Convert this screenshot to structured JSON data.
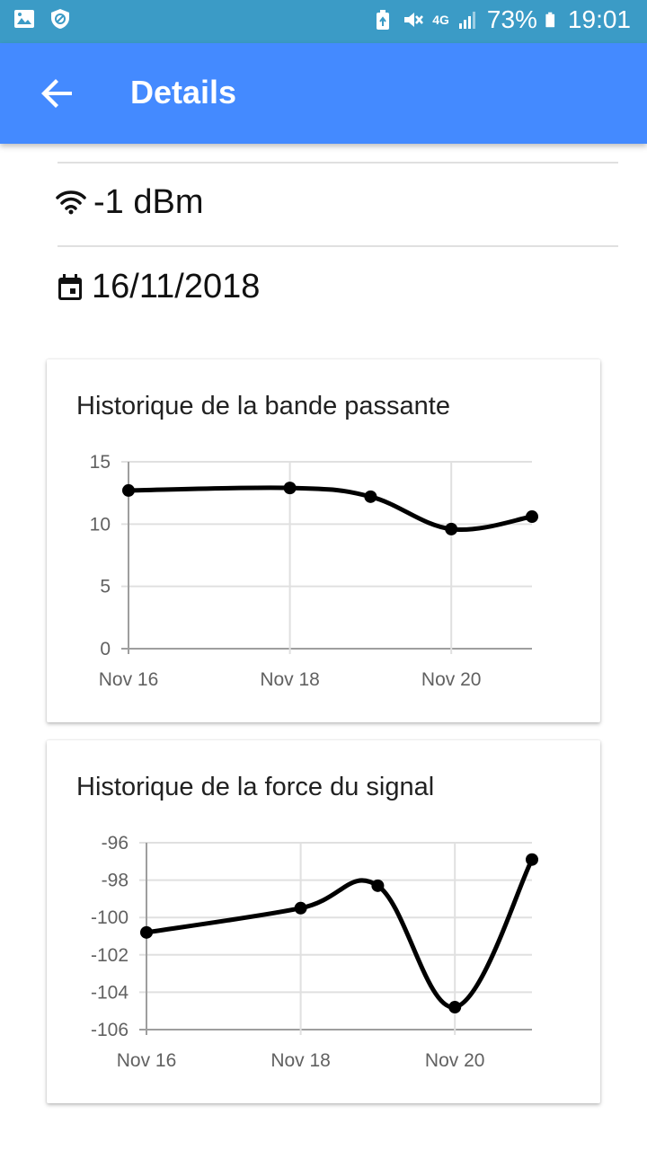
{
  "status_bar": {
    "battery": "73%",
    "time": "19:01",
    "network": "4G",
    "icons": [
      "image-icon",
      "shield-icon",
      "battery-saver-icon",
      "mute-icon",
      "network-4g-icon",
      "signal-icon",
      "battery-icon"
    ]
  },
  "app_bar": {
    "title": "Details",
    "back_icon": "arrow-back-icon",
    "color": "#448AFF"
  },
  "details": {
    "signal": "-1 dBm",
    "signal_icon": "wifi-icon",
    "date": "16/11/2018",
    "date_icon": "calendar-icon"
  },
  "chart_data": [
    {
      "type": "line",
      "title": "Historique de la bande passante",
      "x": [
        "2018-11-16",
        "2018-11-18",
        "2018-11-19",
        "2018-11-20",
        "2018-11-21"
      ],
      "values": [
        12.7,
        12.9,
        12.2,
        9.6,
        10.6
      ],
      "ylim": [
        0,
        15
      ],
      "yticks": [
        "15",
        "10",
        "5",
        "0"
      ],
      "ytick_values": [
        15,
        10,
        5,
        0
      ],
      "xticks": [
        "Nov 16",
        "Nov 18",
        "Nov 20"
      ],
      "xtick_dates": [
        "2018-11-16",
        "2018-11-18",
        "2018-11-20"
      ],
      "xlim": [
        "2018-11-16",
        "2018-11-21"
      ],
      "grid": true,
      "line_color": "#000000"
    },
    {
      "type": "line",
      "title": "Historique de la force du signal",
      "x": [
        "2018-11-16",
        "2018-11-18",
        "2018-11-19",
        "2018-11-20",
        "2018-11-21"
      ],
      "values": [
        -100.8,
        -99.5,
        -98.3,
        -104.8,
        -96.9
      ],
      "ylim": [
        -106,
        -96
      ],
      "yticks": [
        "-96",
        "-98",
        "-100",
        "-102",
        "-104",
        "-106"
      ],
      "ytick_values": [
        -96,
        -98,
        -100,
        -102,
        -104,
        -106
      ],
      "xticks": [
        "Nov 16",
        "Nov 18",
        "Nov 20"
      ],
      "xtick_dates": [
        "2018-11-16",
        "2018-11-18",
        "2018-11-20"
      ],
      "xlim": [
        "2018-11-16",
        "2018-11-21"
      ],
      "grid": true,
      "line_color": "#000000"
    }
  ]
}
